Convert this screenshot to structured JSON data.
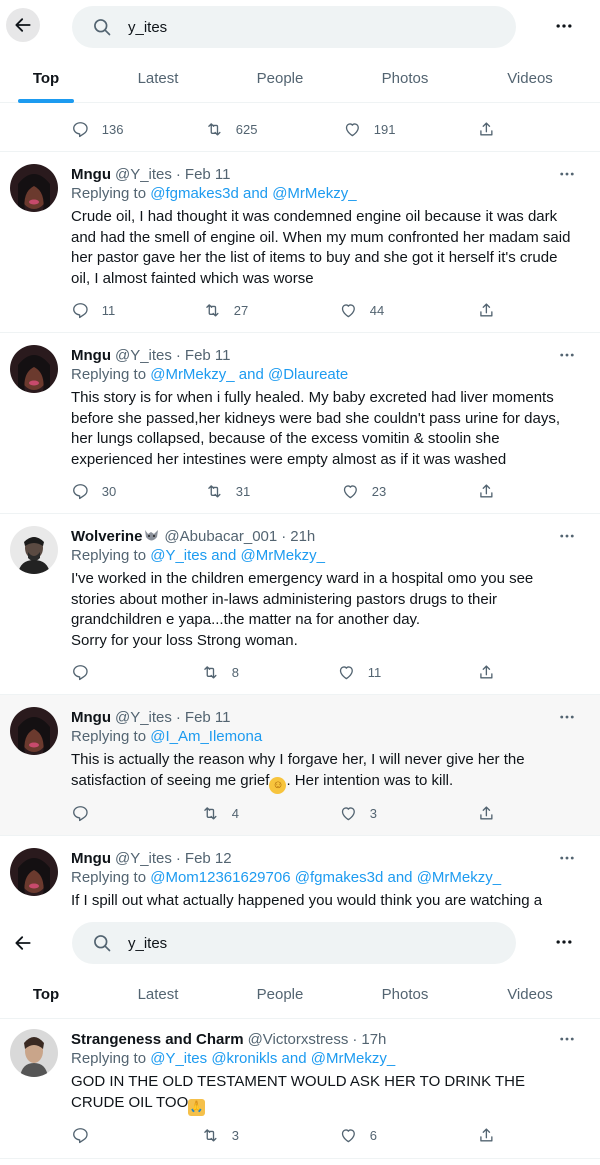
{
  "search": {
    "query": "y_ites"
  },
  "tabs": [
    "Top",
    "Latest",
    "People",
    "Photos",
    "Videos"
  ],
  "prev_actions": {
    "replies": "136",
    "retweets": "625",
    "likes": "191"
  },
  "tweets": [
    {
      "name": "Mngu",
      "handle": "@Y_ites",
      "sep": "·",
      "time": "Feb 11",
      "replying_prefix": "Replying to ",
      "mention1": "@fgmakes3d",
      "and": " and ",
      "mention2": "@MrMekzy_",
      "text": "Crude oil, I had thought it was condemned engine oil because it was dark and had the smell of engine oil. When my mum confronted her madam said her pastor gave her the list of items to buy and she got it herself it's crude oil, I almost fainted which was worse",
      "replies": "11",
      "retweets": "27",
      "likes": "44"
    },
    {
      "name": "Mngu",
      "handle": "@Y_ites",
      "sep": "·",
      "time": "Feb 11",
      "replying_prefix": "Replying to ",
      "mention1": "@MrMekzy_",
      "and": " and ",
      "mention2": "@Dlaureate",
      "text": "This story is for when i fully healed. My baby excreted had liver moments before she passed,her kidneys were bad she couldn't pass urine for days, her lungs collapsed, because of the excess vomitin & stoolin she experienced her intestines were empty almost as if it was washed",
      "replies": "30",
      "retweets": "31",
      "likes": "23"
    },
    {
      "name": "Wolverine",
      "handle": "@Abubacar_001",
      "sep": "·",
      "time": "21h",
      "replying_prefix": "Replying to ",
      "mention1": "@Y_ites",
      "and": " and ",
      "mention2": "@MrMekzy_",
      "text": "I've worked in the children emergency ward in a hospital omo you see stories about mother in-laws administering pastors drugs to their grandchildren e yapa...the matter na for another day.\nSorry for your loss Strong woman.",
      "replies": "",
      "retweets": "8",
      "likes": "11"
    },
    {
      "name": "Mngu",
      "handle": "@Y_ites",
      "sep": "·",
      "time": "Feb 11",
      "replying_prefix": "Replying to ",
      "mention1": "@I_Am_Ilemona",
      "text1": "This is actually the reason why I forgave her, I will never give her the satisfaction of seeing me grief",
      "text2": ". Her intention was to kill.",
      "emoji": "smiling-face-emoji",
      "replies": "",
      "retweets": "4",
      "likes": "3"
    },
    {
      "name": "Mngu",
      "handle": "@Y_ites",
      "sep": "·",
      "time": "Feb 12",
      "replying_prefix": "Replying to ",
      "mention1": "@Mom12361629706",
      "mention_mid": "@fgmakes3d",
      "and": " and ",
      "mention2": "@MrMekzy_",
      "text": "If I spill out what actually happened you would think you are watching a"
    },
    {
      "name": "Strangeness and Charm",
      "handle": "@Victorxstress",
      "sep": "·",
      "time": "17h",
      "replying_prefix": "Replying to ",
      "mention1": "@Y_ites",
      "mention_mid": "@kronikls",
      "and": " and ",
      "mention2": "@MrMekzy_",
      "text1": "GOD IN THE OLD TESTAMENT WOULD ASK HER TO DRINK THE CRUDE OIL TOO",
      "emoji": "folded-hands-emoji",
      "replies": "",
      "retweets": "3",
      "likes": "6"
    }
  ],
  "colors": {
    "accent": "#1d9bf0",
    "secondary_text": "#536471",
    "highlight_bg": "#f7f7f7"
  }
}
